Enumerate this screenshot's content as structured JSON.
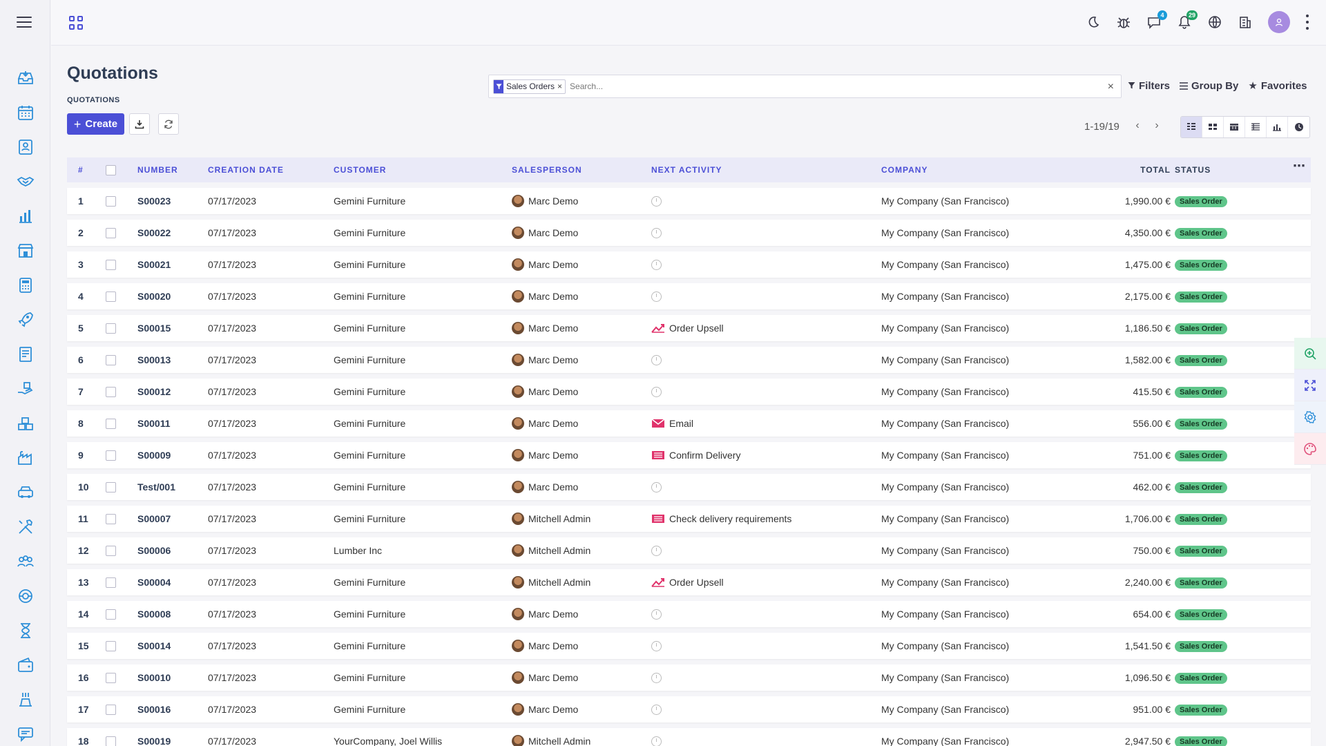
{
  "sidebar": {
    "menu_icon": "hamburger-menu-icon",
    "items": [
      {
        "name": "inbox-icon",
        "color": "#2e8fd8"
      },
      {
        "name": "calendar-icon",
        "color": "#2e8fd8"
      },
      {
        "name": "contacts-icon",
        "color": "#2e8fd8"
      },
      {
        "name": "crm-handshake-icon",
        "color": "#2e8fd8"
      },
      {
        "name": "sales-chart-icon",
        "color": "#2e8fd8"
      },
      {
        "name": "pos-store-icon",
        "color": "#2e8fd8"
      },
      {
        "name": "invoicing-calculator-icon",
        "color": "#2e8fd8"
      },
      {
        "name": "website-rocket-icon",
        "color": "#2e8fd8"
      },
      {
        "name": "purchase-document-icon",
        "color": "#2e8fd8"
      },
      {
        "name": "inventory-hand-icon",
        "color": "#2e8fd8"
      },
      {
        "name": "inventory-boxes-icon",
        "color": "#2e8fd8"
      },
      {
        "name": "manufacturing-factory-icon",
        "color": "#2e8fd8"
      },
      {
        "name": "fleet-car-icon",
        "color": "#2e8fd8"
      },
      {
        "name": "repair-tools-icon",
        "color": "#2e8fd8"
      },
      {
        "name": "employees-icon",
        "color": "#2e8fd8"
      },
      {
        "name": "support-icon",
        "color": "#2e8fd8"
      },
      {
        "name": "timesheet-hourglass-icon",
        "color": "#2e8fd8"
      },
      {
        "name": "expenses-wallet-icon",
        "color": "#2e8fd8"
      },
      {
        "name": "lunch-icon",
        "color": "#2e8fd8"
      },
      {
        "name": "discuss-chat-icon",
        "color": "#2e8fd8"
      }
    ]
  },
  "topbar": {
    "apps_icon": "apps-grid-icon",
    "icons": [
      {
        "name": "dark-mode-moon-icon"
      },
      {
        "name": "debug-bug-icon"
      },
      {
        "name": "messages-chat-icon",
        "badge": "4",
        "badge_color": "blue"
      },
      {
        "name": "notifications-bell-icon",
        "badge": "29",
        "badge_color": "green"
      },
      {
        "name": "language-globe-icon"
      },
      {
        "name": "company-building-icon"
      }
    ],
    "avatar_icon": "user-avatar-icon",
    "more_icon": "kebab-menu-icon"
  },
  "page": {
    "title": "Quotations",
    "breadcrumb_sub": "QUOTATIONS",
    "create_label": "Create",
    "download_icon": "download-icon",
    "refresh_icon": "refresh-icon"
  },
  "search": {
    "facet_label": "Sales Orders",
    "facet_icon": "filter-icon",
    "facet_remove": "×",
    "placeholder": "Search...",
    "clear": "×",
    "filters_label": "Filters",
    "groupby_label": "Group By",
    "favorites_label": "Favorites"
  },
  "pager": {
    "value": "1-19/19",
    "prev_icon": "chevron-left-icon",
    "next_icon": "chevron-right-icon"
  },
  "views": [
    {
      "name": "list-view-icon",
      "active": true
    },
    {
      "name": "kanban-view-icon",
      "active": false
    },
    {
      "name": "calendar-view-icon",
      "active": false
    },
    {
      "name": "pivot-view-icon",
      "active": false
    },
    {
      "name": "graph-view-icon",
      "active": false
    },
    {
      "name": "activity-view-icon",
      "active": false
    }
  ],
  "table": {
    "headers": {
      "num": "#",
      "number": "NUMBER",
      "date": "CREATION DATE",
      "customer": "CUSTOMER",
      "salesperson": "SALESPERSON",
      "activity": "NEXT ACTIVITY",
      "company": "COMPANY",
      "total": "TOTAL",
      "status": "STATUS"
    },
    "more": "⋯",
    "rows": [
      {
        "n": "1",
        "number": "S00023",
        "date": "07/17/2023",
        "customer": "Gemini Furniture",
        "salesperson": "Marc Demo",
        "activity": "",
        "activity_type": "none",
        "company": "My Company (San Francisco)",
        "total": "1,990.00 €",
        "status": "Sales Order"
      },
      {
        "n": "2",
        "number": "S00022",
        "date": "07/17/2023",
        "customer": "Gemini Furniture",
        "salesperson": "Marc Demo",
        "activity": "",
        "activity_type": "none",
        "company": "My Company (San Francisco)",
        "total": "4,350.00 €",
        "status": "Sales Order"
      },
      {
        "n": "3",
        "number": "S00021",
        "date": "07/17/2023",
        "customer": "Gemini Furniture",
        "salesperson": "Marc Demo",
        "activity": "",
        "activity_type": "none",
        "company": "My Company (San Francisco)",
        "total": "1,475.00 €",
        "status": "Sales Order"
      },
      {
        "n": "4",
        "number": "S00020",
        "date": "07/17/2023",
        "customer": "Gemini Furniture",
        "salesperson": "Marc Demo",
        "activity": "",
        "activity_type": "none",
        "company": "My Company (San Francisco)",
        "total": "2,175.00 €",
        "status": "Sales Order"
      },
      {
        "n": "5",
        "number": "S00015",
        "date": "07/17/2023",
        "customer": "Gemini Furniture",
        "salesperson": "Marc Demo",
        "activity": "Order Upsell",
        "activity_type": "upsell",
        "company": "My Company (San Francisco)",
        "total": "1,186.50 €",
        "status": "Sales Order"
      },
      {
        "n": "6",
        "number": "S00013",
        "date": "07/17/2023",
        "customer": "Gemini Furniture",
        "salesperson": "Marc Demo",
        "activity": "",
        "activity_type": "none",
        "company": "My Company (San Francisco)",
        "total": "1,582.00 €",
        "status": "Sales Order"
      },
      {
        "n": "7",
        "number": "S00012",
        "date": "07/17/2023",
        "customer": "Gemini Furniture",
        "salesperson": "Marc Demo",
        "activity": "",
        "activity_type": "none",
        "company": "My Company (San Francisco)",
        "total": "415.50 €",
        "status": "Sales Order"
      },
      {
        "n": "8",
        "number": "S00011",
        "date": "07/17/2023",
        "customer": "Gemini Furniture",
        "salesperson": "Marc Demo",
        "activity": "Email",
        "activity_type": "email",
        "company": "My Company (San Francisco)",
        "total": "556.00 €",
        "status": "Sales Order"
      },
      {
        "n": "9",
        "number": "S00009",
        "date": "07/17/2023",
        "customer": "Gemini Furniture",
        "salesperson": "Marc Demo",
        "activity": "Confirm Delivery",
        "activity_type": "todo",
        "company": "My Company (San Francisco)",
        "total": "751.00 €",
        "status": "Sales Order"
      },
      {
        "n": "10",
        "number": "Test/001",
        "date": "07/17/2023",
        "customer": "Gemini Furniture",
        "salesperson": "Marc Demo",
        "activity": "",
        "activity_type": "none",
        "company": "My Company (San Francisco)",
        "total": "462.00 €",
        "status": "Sales Order"
      },
      {
        "n": "11",
        "number": "S00007",
        "date": "07/17/2023",
        "customer": "Gemini Furniture",
        "salesperson": "Mitchell Admin",
        "activity": "Check delivery requirements",
        "activity_type": "todo",
        "company": "My Company (San Francisco)",
        "total": "1,706.00 €",
        "status": "Sales Order"
      },
      {
        "n": "12",
        "number": "S00006",
        "date": "07/17/2023",
        "customer": "Lumber Inc",
        "salesperson": "Mitchell Admin",
        "activity": "",
        "activity_type": "none",
        "company": "My Company (San Francisco)",
        "total": "750.00 €",
        "status": "Sales Order"
      },
      {
        "n": "13",
        "number": "S00004",
        "date": "07/17/2023",
        "customer": "Gemini Furniture",
        "salesperson": "Mitchell Admin",
        "activity": "Order Upsell",
        "activity_type": "upsell",
        "company": "My Company (San Francisco)",
        "total": "2,240.00 €",
        "status": "Sales Order"
      },
      {
        "n": "14",
        "number": "S00008",
        "date": "07/17/2023",
        "customer": "Gemini Furniture",
        "salesperson": "Marc Demo",
        "activity": "",
        "activity_type": "none",
        "company": "My Company (San Francisco)",
        "total": "654.00 €",
        "status": "Sales Order"
      },
      {
        "n": "15",
        "number": "S00014",
        "date": "07/17/2023",
        "customer": "Gemini Furniture",
        "salesperson": "Marc Demo",
        "activity": "",
        "activity_type": "none",
        "company": "My Company (San Francisco)",
        "total": "1,541.50 €",
        "status": "Sales Order"
      },
      {
        "n": "16",
        "number": "S00010",
        "date": "07/17/2023",
        "customer": "Gemini Furniture",
        "salesperson": "Marc Demo",
        "activity": "",
        "activity_type": "none",
        "company": "My Company (San Francisco)",
        "total": "1,096.50 €",
        "status": "Sales Order"
      },
      {
        "n": "17",
        "number": "S00016",
        "date": "07/17/2023",
        "customer": "Gemini Furniture",
        "salesperson": "Marc Demo",
        "activity": "",
        "activity_type": "none",
        "company": "My Company (San Francisco)",
        "total": "951.00 €",
        "status": "Sales Order"
      },
      {
        "n": "18",
        "number": "S00019",
        "date": "07/17/2023",
        "customer": "YourCompany, Joel Willis",
        "salesperson": "Mitchell Admin",
        "activity": "",
        "activity_type": "none",
        "company": "My Company (San Francisco)",
        "total": "2,947.50 €",
        "status": "Sales Order"
      }
    ]
  },
  "float_tools": [
    {
      "name": "zoom-in-icon",
      "color": "#21a366"
    },
    {
      "name": "fullscreen-expand-icon",
      "color": "#4b4fd6"
    },
    {
      "name": "settings-gear-icon",
      "color": "#2e8fd8"
    },
    {
      "name": "theme-palette-icon",
      "color": "#e0507a"
    }
  ],
  "colors": {
    "accent": "#4b4fd6",
    "status_green": "#5fc58a",
    "activity_red": "#e0336b"
  }
}
